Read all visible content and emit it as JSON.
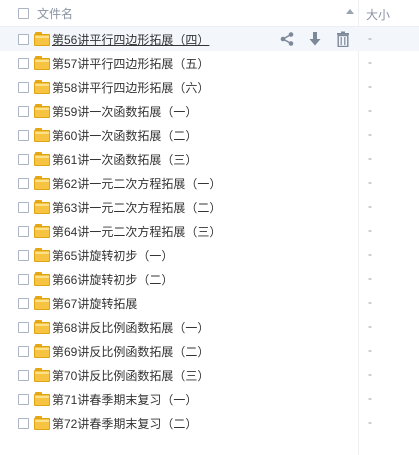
{
  "header": {
    "name_label": "文件名",
    "size_label": "大小"
  },
  "rows": [
    {
      "name": "第56讲平行四边形拓展（四）",
      "size": "-"
    },
    {
      "name": "第57讲平行四边形拓展（五）",
      "size": "-"
    },
    {
      "name": "第58讲平行四边形拓展（六）",
      "size": "-"
    },
    {
      "name": "第59讲一次函数拓展（一）",
      "size": "-"
    },
    {
      "name": "第60讲一次函数拓展（二）",
      "size": "-"
    },
    {
      "name": "第61讲一次函数拓展（三）",
      "size": "-"
    },
    {
      "name": "第62讲一元二次方程拓展（一）",
      "size": "-"
    },
    {
      "name": "第63讲一元二次方程拓展（二）",
      "size": "-"
    },
    {
      "name": "第64讲一元二次方程拓展（三）",
      "size": "-"
    },
    {
      "name": "第65讲旋转初步（一）",
      "size": "-"
    },
    {
      "name": "第66讲旋转初步（二）",
      "size": "-"
    },
    {
      "name": "第67讲旋转拓展",
      "size": "-"
    },
    {
      "name": "第68讲反比例函数拓展（一）",
      "size": "-"
    },
    {
      "name": "第69讲反比例函数拓展（二）",
      "size": "-"
    },
    {
      "name": "第70讲反比例函数拓展（三）",
      "size": "-"
    },
    {
      "name": "第71讲春季期末复习（一）",
      "size": "-"
    },
    {
      "name": "第72讲春季期末复习（二）",
      "size": "-"
    }
  ],
  "hover_actions": [
    "share-icon",
    "download-icon",
    "delete-icon"
  ],
  "colors": {
    "icon": "#7d8898",
    "folder": "#f7c342",
    "hover_row": "#f3f6fb"
  }
}
